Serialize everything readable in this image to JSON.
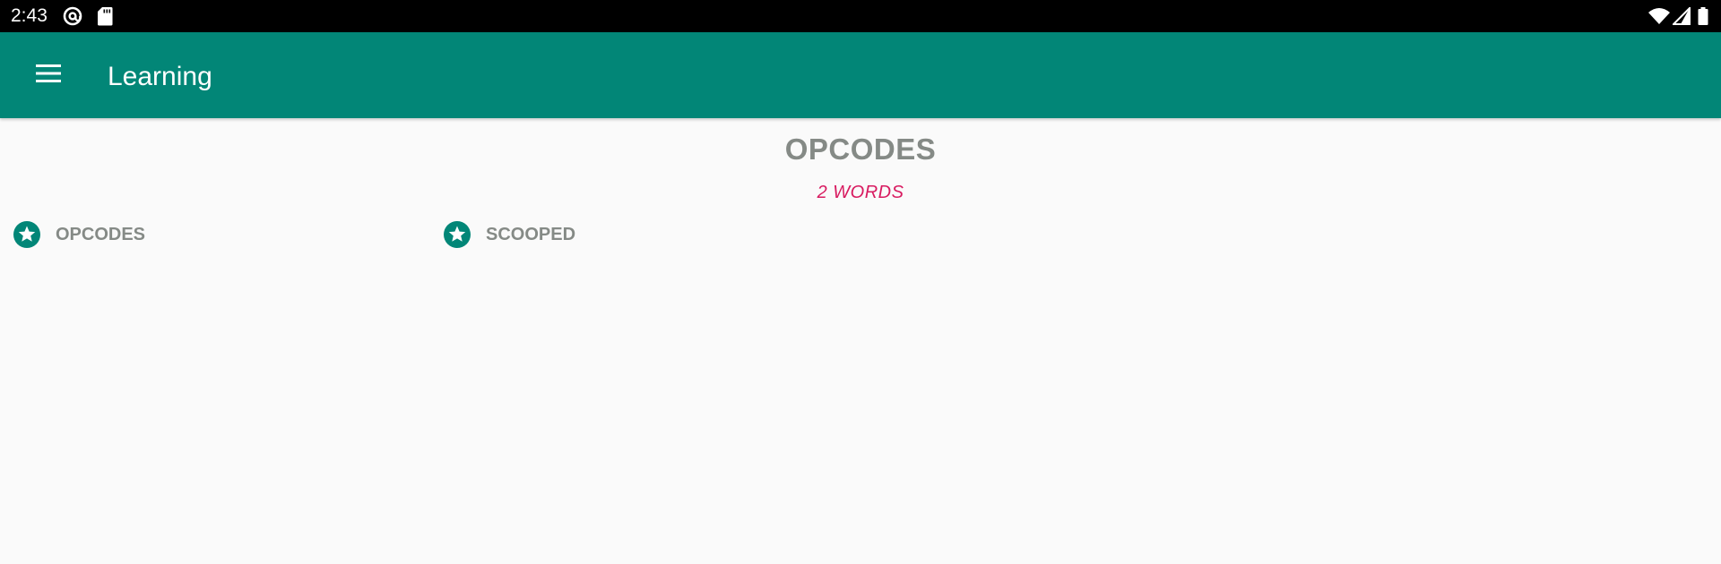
{
  "status_bar": {
    "time": "2:43",
    "left_icons": [
      "at-sign-icon",
      "sd-card-icon"
    ],
    "right_icons": [
      "wifi-icon",
      "cell-signal-icon",
      "battery-icon"
    ]
  },
  "app_bar": {
    "menu_icon": "hamburger-menu-icon",
    "title": "Learning"
  },
  "section": {
    "title": "OPCODES",
    "word_count": "2 WORDS",
    "words": [
      {
        "label": "OPCODES",
        "icon": "star-badge-icon"
      },
      {
        "label": "SCOOPED",
        "icon": "star-badge-icon"
      }
    ]
  },
  "colors": {
    "accent": "#028677",
    "count_text": "#D81B60",
    "muted_text": "#858A86",
    "background": "#FAFAFA"
  }
}
